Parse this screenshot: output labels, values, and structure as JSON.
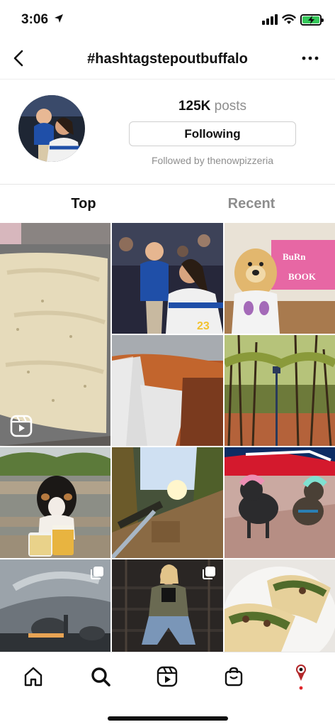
{
  "status_bar": {
    "time": "3:06"
  },
  "header": {
    "title": "#hashtagstepoutbuffalo"
  },
  "profile": {
    "posts_count": "125K",
    "posts_label": "posts",
    "follow_button": "Following",
    "followed_by": "Followed by thenowpizzeria"
  },
  "tabs": [
    {
      "label": "Top",
      "selected": true
    },
    {
      "label": "Recent",
      "selected": false
    }
  ],
  "grid": {
    "tiles": [
      {
        "subject": "pizza dough in pan",
        "badge": "reels-icon"
      },
      {
        "subject": "hockey fans with child"
      },
      {
        "subject": "golden retriever with Burn Book sign"
      },
      {
        "subject": "autumn waterfall"
      },
      {
        "subject": "forest path with lamp post"
      },
      {
        "subject": "dog with beers at picnic table"
      },
      {
        "subject": "wooded path with sunlight"
      },
      {
        "subject": "two dogs in Bills costumes"
      },
      {
        "subject": "conservatory under cloudy sky",
        "badge": "carousel-icon"
      },
      {
        "subject": "woman sitting on stairs",
        "badge": "carousel-icon"
      },
      {
        "subject": "plate of tacos"
      }
    ]
  },
  "bottom_nav": [
    {
      "icon": "home-icon"
    },
    {
      "icon": "search-icon",
      "active": true
    },
    {
      "icon": "reels-icon"
    },
    {
      "icon": "shop-icon"
    },
    {
      "icon": "profile-icon"
    }
  ],
  "colors": {
    "muted_text": "#8e8e8e",
    "battery": "#34c759",
    "notification_dot": "#e0262b"
  }
}
